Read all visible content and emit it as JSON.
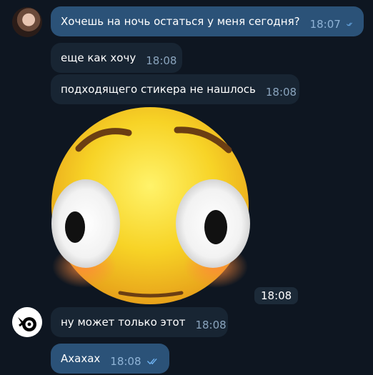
{
  "messages": [
    {
      "text": "Хочешь на ночь остаться у меня сегодня?",
      "time": "18:07",
      "direction": "out",
      "read": true
    },
    {
      "text": "еще как хочу",
      "time": "18:08",
      "direction": "in"
    },
    {
      "text": "подходящего стикера не нашлось",
      "time": "18:08",
      "direction": "in"
    },
    {
      "sticker": "flushed-face-sticker",
      "time": "18:08",
      "direction": "in"
    },
    {
      "text": "ну может только этот",
      "time": "18:08",
      "direction": "in"
    },
    {
      "text": "Ахахах",
      "time": "18:08",
      "direction": "out",
      "read": true
    }
  ],
  "colors": {
    "background": "#0e1621",
    "outgoing_bubble": "#2b5278",
    "incoming_bubble": "#182533",
    "read_check": "#6fb3f2"
  }
}
